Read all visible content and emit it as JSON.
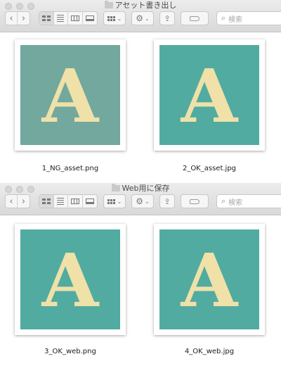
{
  "colors": {
    "teal": "#52aba0",
    "teal_ng": "#72a89d",
    "letter": "#efe1a8"
  },
  "windows": [
    {
      "title": "アセット書き出し",
      "search_placeholder": "検索",
      "toolbar": {
        "back": "‹",
        "forward": "›",
        "action_icon": "gear-icon",
        "share_icon": "share-icon"
      },
      "files": [
        {
          "name": "1_NG_asset.png",
          "glyph": "A",
          "variant": "ng"
        },
        {
          "name": "2_OK_asset.jpg",
          "glyph": "A",
          "variant": "ok"
        }
      ]
    },
    {
      "title": "Web用に保存",
      "search_placeholder": "検索",
      "toolbar": {
        "back": "‹",
        "forward": "›",
        "action_icon": "gear-icon",
        "share_icon": "share-icon"
      },
      "files": [
        {
          "name": "3_OK_web.png",
          "glyph": "A",
          "variant": "ok"
        },
        {
          "name": "4_OK_web.jpg",
          "glyph": "A",
          "variant": "ok"
        }
      ]
    }
  ]
}
